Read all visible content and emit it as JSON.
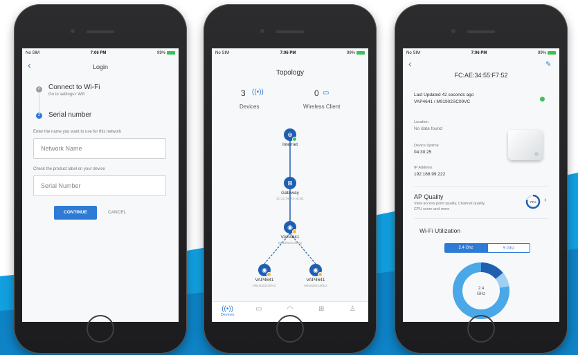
{
  "status": {
    "carrier": "No SIM",
    "time": "7:06 PM",
    "battery": "99%"
  },
  "login": {
    "title": "Login",
    "back_icon": "chevron-left-icon",
    "step1": {
      "title": "Connect to Wi-Fi",
      "subtitle": "Go to settings> Wifi"
    },
    "step2": {
      "number": "2",
      "title": "Serial number"
    },
    "network_prompt": "Enter the name you want to use for this network",
    "network_placeholder": "Network Name",
    "serial_prompt": "Check the product label on your device",
    "serial_placeholder": "Serial Number",
    "continue_label": "CONTINUE",
    "cancel_label": "CANCEL"
  },
  "topology": {
    "title": "Topology",
    "devices_count": "3",
    "devices_label": "Devices",
    "clients_count": "0",
    "clients_label": "Wireless Client",
    "nodes": {
      "internet": {
        "label": "Internet"
      },
      "gateway": {
        "label": "Gateway",
        "sub": "3C:2C:99:A2:AE:B1"
      },
      "vap_main": {
        "label": "VAP4641",
        "sub": "M91902SC09VQ"
      },
      "vap_left": {
        "label": "VAP4641",
        "sub": "M91902SC09VC"
      },
      "vap_right": {
        "label": "VAP4641",
        "sub": "M91839SC00D2"
      }
    },
    "tabs": [
      {
        "label": "Devices"
      }
    ]
  },
  "details": {
    "mac": "FC:AE:34:55:F7:52",
    "last_updated": "Last Updated 42 seconds ago",
    "model_serial": "VAP4641 / M91902SC09VC",
    "location_label": "Location",
    "location_value": "No data found",
    "uptime_label": "Device Uptime",
    "uptime_value": "04:30:25",
    "ip_label": "IP Address",
    "ip_value": "192.168.99.222",
    "ap_quality_title": "AP Quality",
    "ap_quality_desc1": "View access point quality, Channel quality,",
    "ap_quality_desc2": "CPU score and more",
    "ap_quality_value": "79%",
    "ap_quality_fraction": 0.79,
    "wifi_title": "Wi-Fi Utilization",
    "band_24": "2.4 Ghz",
    "band_5": "5 Ghz",
    "donut_line1": "2.4",
    "donut_line2": "GHz"
  },
  "colors": {
    "accent": "#2e7bd6",
    "node": "#1f5fb0",
    "online": "#3cc05a",
    "warning": "#f5b82e",
    "wave": "#0f86c9"
  }
}
